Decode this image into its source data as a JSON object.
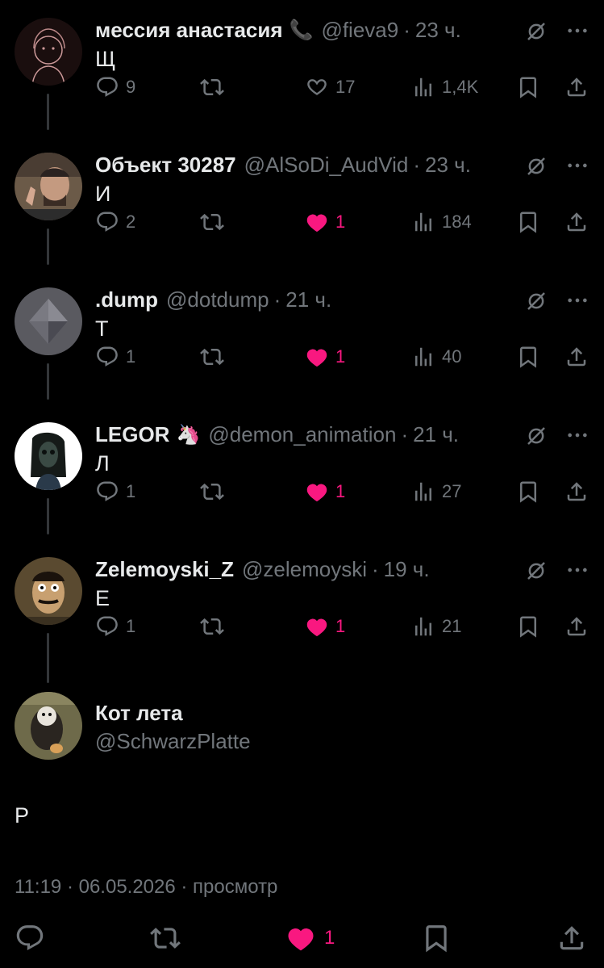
{
  "colors": {
    "background": "#000000",
    "text": "#e7e9ea",
    "muted": "#71767b",
    "like": "#f91880",
    "thread_line": "#333639"
  },
  "replies": [
    {
      "name": "мессия анастасия",
      "emoji": "📞",
      "handle": "@fieva9",
      "time": "23 ч.",
      "text": "Щ",
      "counts": {
        "replies": "9",
        "retweets": "",
        "likes": "17",
        "views": "1,4K"
      },
      "liked": false
    },
    {
      "name": "Объект 30287",
      "emoji": "",
      "handle": "@AlSoDi_AudVid",
      "time": "23 ч.",
      "text": "И",
      "counts": {
        "replies": "2",
        "retweets": "",
        "likes": "1",
        "views": "184"
      },
      "liked": true
    },
    {
      "name": ".dump",
      "emoji": "",
      "handle": "@dotdump",
      "time": "21 ч.",
      "text": "Т",
      "counts": {
        "replies": "1",
        "retweets": "",
        "likes": "1",
        "views": "40"
      },
      "liked": true
    },
    {
      "name": "LEGOR",
      "emoji": "🦄",
      "handle": "@demon_animation",
      "time": "21 ч.",
      "text": "Л",
      "counts": {
        "replies": "1",
        "retweets": "",
        "likes": "1",
        "views": "27"
      },
      "liked": true
    },
    {
      "name": "Zelemoyski_Z",
      "emoji": "",
      "handle": "@zelemoyski",
      "time": "19 ч.",
      "text": "Е",
      "counts": {
        "replies": "1",
        "retweets": "",
        "likes": "1",
        "views": "21"
      },
      "liked": true
    }
  ],
  "main_tweet": {
    "name": "Кот лета",
    "handle": "@SchwarzPlatte",
    "text": "Р",
    "meta": "11:19 · 06.05.2026 · просмотр",
    "likes": "1"
  },
  "icons": [
    "reply-icon",
    "retweet-icon",
    "heart-icon",
    "views-icon",
    "bookmark-icon",
    "share-icon",
    "grok-icon",
    "more-icon"
  ]
}
